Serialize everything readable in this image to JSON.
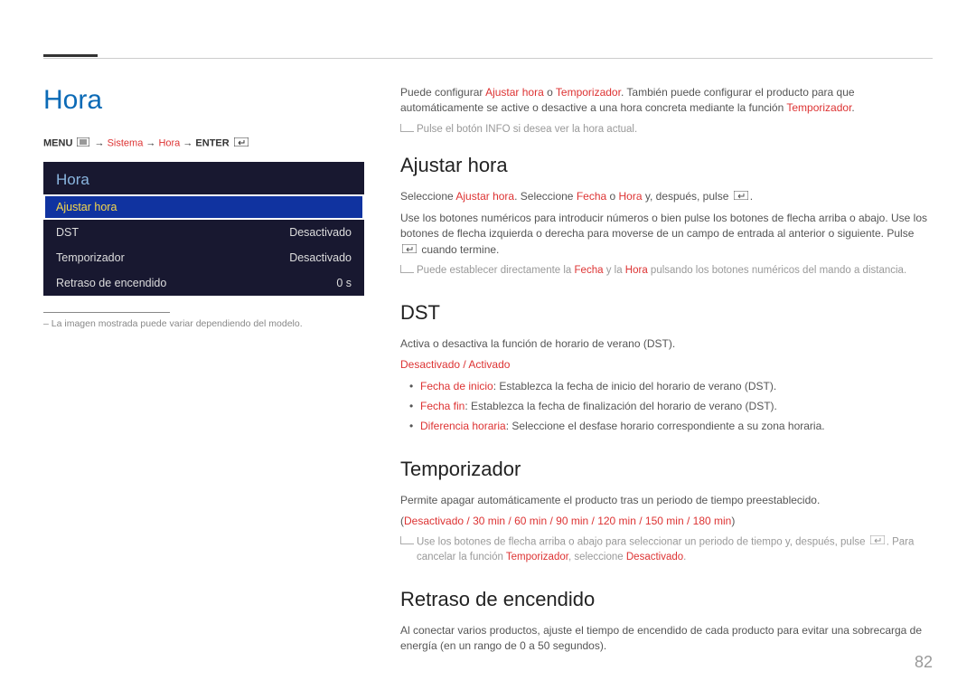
{
  "pageTitle": "Hora",
  "breadcrumb": {
    "p1": "MENU",
    "p2": "Sistema",
    "p3": "Hora",
    "p4": "ENTER",
    "arrow": "→"
  },
  "osd": {
    "title": "Hora",
    "rows": [
      {
        "label": "Ajustar hora",
        "value": ""
      },
      {
        "label": "DST",
        "value": "Desactivado"
      },
      {
        "label": "Temporizador",
        "value": "Desactivado"
      },
      {
        "label": "Retraso de encendido",
        "value": "0 s"
      }
    ]
  },
  "caption": "La imagen mostrada puede variar dependiendo del modelo.",
  "intro": {
    "t1a": "Puede configurar ",
    "t1b": "Ajustar hora",
    "t1c": " o ",
    "t1d": "Temporizador",
    "t1e": ". También puede configurar el producto para que automáticamente se active o desactive a una hora concreta mediante la función ",
    "t1f": "Temporizador",
    "t1g": ".",
    "note": "Pulse el botón INFO si desea ver la hora actual."
  },
  "ajustar": {
    "heading": "Ajustar hora",
    "p1a": "Seleccione ",
    "p1b": "Ajustar hora",
    "p1c": ". Seleccione ",
    "p1d": "Fecha",
    "p1e": " o ",
    "p1f": "Hora",
    "p1g": " y, después, pulse ",
    "p1h": ".",
    "p2": "Use los botones numéricos para introducir números o bien pulse los botones de flecha arriba o abajo. Use los botones de flecha izquierda o derecha para moverse de un campo de entrada al anterior o siguiente. Pulse ",
    "p2b": "cuando termine.",
    "note_a": "Puede establecer directamente la ",
    "note_b": "Fecha",
    "note_c": " y la ",
    "note_d": "Hora",
    "note_e": " pulsando los botones numéricos del mando a distancia."
  },
  "dst": {
    "heading": "DST",
    "p1": "Activa o desactiva la función de horario de verano (DST).",
    "opt1": "Desactivado",
    "opt2": "Activado",
    "slash": " / ",
    "b1a": "Fecha de inicio",
    "b1b": ": Establezca la fecha de inicio del horario de verano (DST).",
    "b2a": "Fecha fin",
    "b2b": ": Establezca la fecha de finalización del horario de verano (DST).",
    "b3a": "Diferencia horaria",
    "b3b": ": Seleccione el desfase horario correspondiente a su zona horaria."
  },
  "temporizador": {
    "heading": "Temporizador",
    "p1": "Permite apagar automáticamente el producto tras un periodo de tiempo preestablecido.",
    "opts": [
      "Desactivado",
      "30 min",
      "60 min",
      "90 min",
      "120 min",
      "150 min",
      "180 min"
    ],
    "note_a": "Use los botones de flecha arriba o abajo para seleccionar un periodo de tiempo y, después, pulse ",
    "note_b": ". Para cancelar la función ",
    "note_c": "Temporizador",
    "note_d": ", seleccione ",
    "note_e": "Desactivado",
    "note_f": "."
  },
  "retraso": {
    "heading": "Retraso de encendido",
    "p1": "Al conectar varios productos, ajuste el tiempo de encendido de cada producto para evitar una sobrecarga de energía (en un rango de 0 a 50 segundos)."
  },
  "pageNumber": "82"
}
